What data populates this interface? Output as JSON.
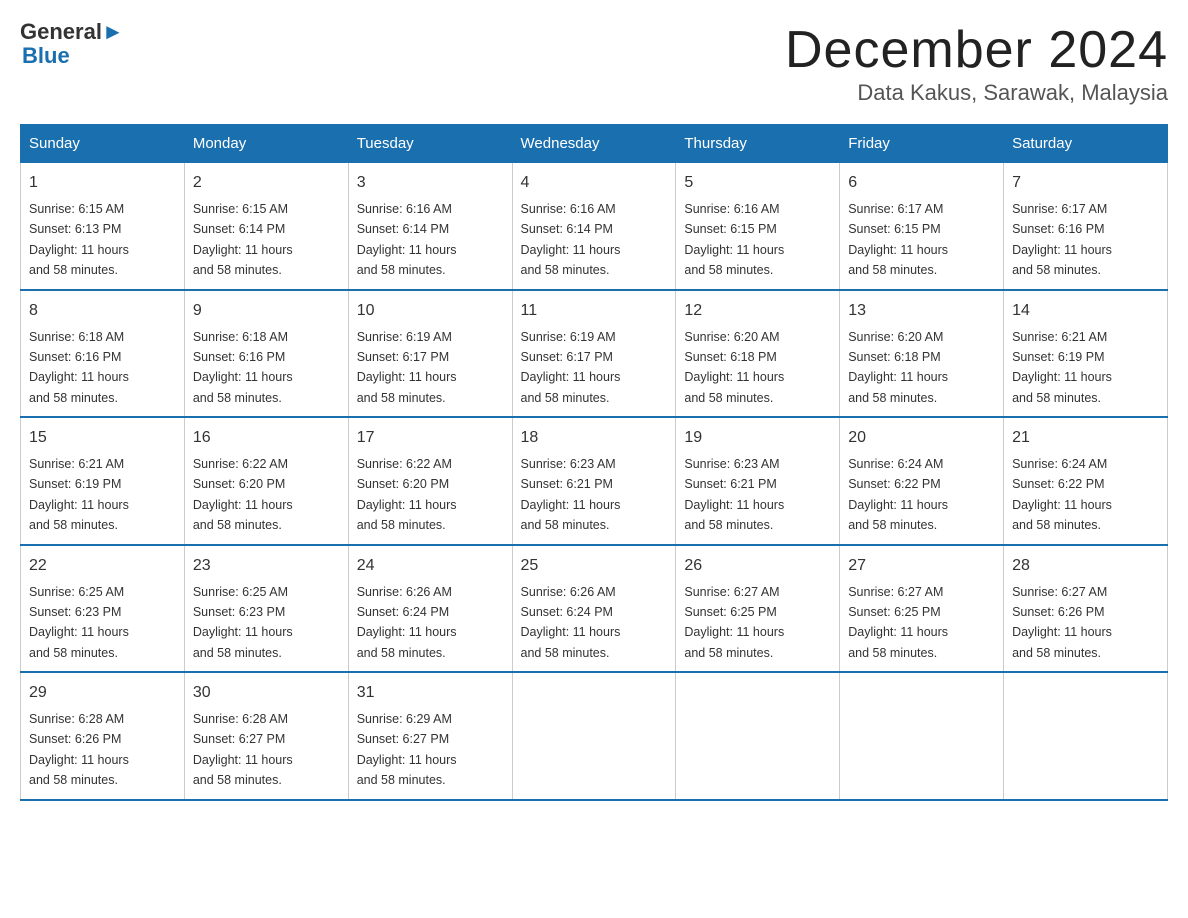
{
  "header": {
    "logo_general": "General",
    "logo_blue": "Blue",
    "title": "December 2024",
    "subtitle": "Data Kakus, Sarawak, Malaysia"
  },
  "days_of_week": [
    "Sunday",
    "Monday",
    "Tuesday",
    "Wednesday",
    "Thursday",
    "Friday",
    "Saturday"
  ],
  "weeks": [
    [
      {
        "day": "1",
        "sunrise": "6:15 AM",
        "sunset": "6:13 PM",
        "daylight": "11 hours and 58 minutes."
      },
      {
        "day": "2",
        "sunrise": "6:15 AM",
        "sunset": "6:14 PM",
        "daylight": "11 hours and 58 minutes."
      },
      {
        "day": "3",
        "sunrise": "6:16 AM",
        "sunset": "6:14 PM",
        "daylight": "11 hours and 58 minutes."
      },
      {
        "day": "4",
        "sunrise": "6:16 AM",
        "sunset": "6:14 PM",
        "daylight": "11 hours and 58 minutes."
      },
      {
        "day": "5",
        "sunrise": "6:16 AM",
        "sunset": "6:15 PM",
        "daylight": "11 hours and 58 minutes."
      },
      {
        "day": "6",
        "sunrise": "6:17 AM",
        "sunset": "6:15 PM",
        "daylight": "11 hours and 58 minutes."
      },
      {
        "day": "7",
        "sunrise": "6:17 AM",
        "sunset": "6:16 PM",
        "daylight": "11 hours and 58 minutes."
      }
    ],
    [
      {
        "day": "8",
        "sunrise": "6:18 AM",
        "sunset": "6:16 PM",
        "daylight": "11 hours and 58 minutes."
      },
      {
        "day": "9",
        "sunrise": "6:18 AM",
        "sunset": "6:16 PM",
        "daylight": "11 hours and 58 minutes."
      },
      {
        "day": "10",
        "sunrise": "6:19 AM",
        "sunset": "6:17 PM",
        "daylight": "11 hours and 58 minutes."
      },
      {
        "day": "11",
        "sunrise": "6:19 AM",
        "sunset": "6:17 PM",
        "daylight": "11 hours and 58 minutes."
      },
      {
        "day": "12",
        "sunrise": "6:20 AM",
        "sunset": "6:18 PM",
        "daylight": "11 hours and 58 minutes."
      },
      {
        "day": "13",
        "sunrise": "6:20 AM",
        "sunset": "6:18 PM",
        "daylight": "11 hours and 58 minutes."
      },
      {
        "day": "14",
        "sunrise": "6:21 AM",
        "sunset": "6:19 PM",
        "daylight": "11 hours and 58 minutes."
      }
    ],
    [
      {
        "day": "15",
        "sunrise": "6:21 AM",
        "sunset": "6:19 PM",
        "daylight": "11 hours and 58 minutes."
      },
      {
        "day": "16",
        "sunrise": "6:22 AM",
        "sunset": "6:20 PM",
        "daylight": "11 hours and 58 minutes."
      },
      {
        "day": "17",
        "sunrise": "6:22 AM",
        "sunset": "6:20 PM",
        "daylight": "11 hours and 58 minutes."
      },
      {
        "day": "18",
        "sunrise": "6:23 AM",
        "sunset": "6:21 PM",
        "daylight": "11 hours and 58 minutes."
      },
      {
        "day": "19",
        "sunrise": "6:23 AM",
        "sunset": "6:21 PM",
        "daylight": "11 hours and 58 minutes."
      },
      {
        "day": "20",
        "sunrise": "6:24 AM",
        "sunset": "6:22 PM",
        "daylight": "11 hours and 58 minutes."
      },
      {
        "day": "21",
        "sunrise": "6:24 AM",
        "sunset": "6:22 PM",
        "daylight": "11 hours and 58 minutes."
      }
    ],
    [
      {
        "day": "22",
        "sunrise": "6:25 AM",
        "sunset": "6:23 PM",
        "daylight": "11 hours and 58 minutes."
      },
      {
        "day": "23",
        "sunrise": "6:25 AM",
        "sunset": "6:23 PM",
        "daylight": "11 hours and 58 minutes."
      },
      {
        "day": "24",
        "sunrise": "6:26 AM",
        "sunset": "6:24 PM",
        "daylight": "11 hours and 58 minutes."
      },
      {
        "day": "25",
        "sunrise": "6:26 AM",
        "sunset": "6:24 PM",
        "daylight": "11 hours and 58 minutes."
      },
      {
        "day": "26",
        "sunrise": "6:27 AM",
        "sunset": "6:25 PM",
        "daylight": "11 hours and 58 minutes."
      },
      {
        "day": "27",
        "sunrise": "6:27 AM",
        "sunset": "6:25 PM",
        "daylight": "11 hours and 58 minutes."
      },
      {
        "day": "28",
        "sunrise": "6:27 AM",
        "sunset": "6:26 PM",
        "daylight": "11 hours and 58 minutes."
      }
    ],
    [
      {
        "day": "29",
        "sunrise": "6:28 AM",
        "sunset": "6:26 PM",
        "daylight": "11 hours and 58 minutes."
      },
      {
        "day": "30",
        "sunrise": "6:28 AM",
        "sunset": "6:27 PM",
        "daylight": "11 hours and 58 minutes."
      },
      {
        "day": "31",
        "sunrise": "6:29 AM",
        "sunset": "6:27 PM",
        "daylight": "11 hours and 58 minutes."
      },
      null,
      null,
      null,
      null
    ]
  ],
  "labels": {
    "sunrise": "Sunrise:",
    "sunset": "Sunset:",
    "daylight": "Daylight:"
  }
}
